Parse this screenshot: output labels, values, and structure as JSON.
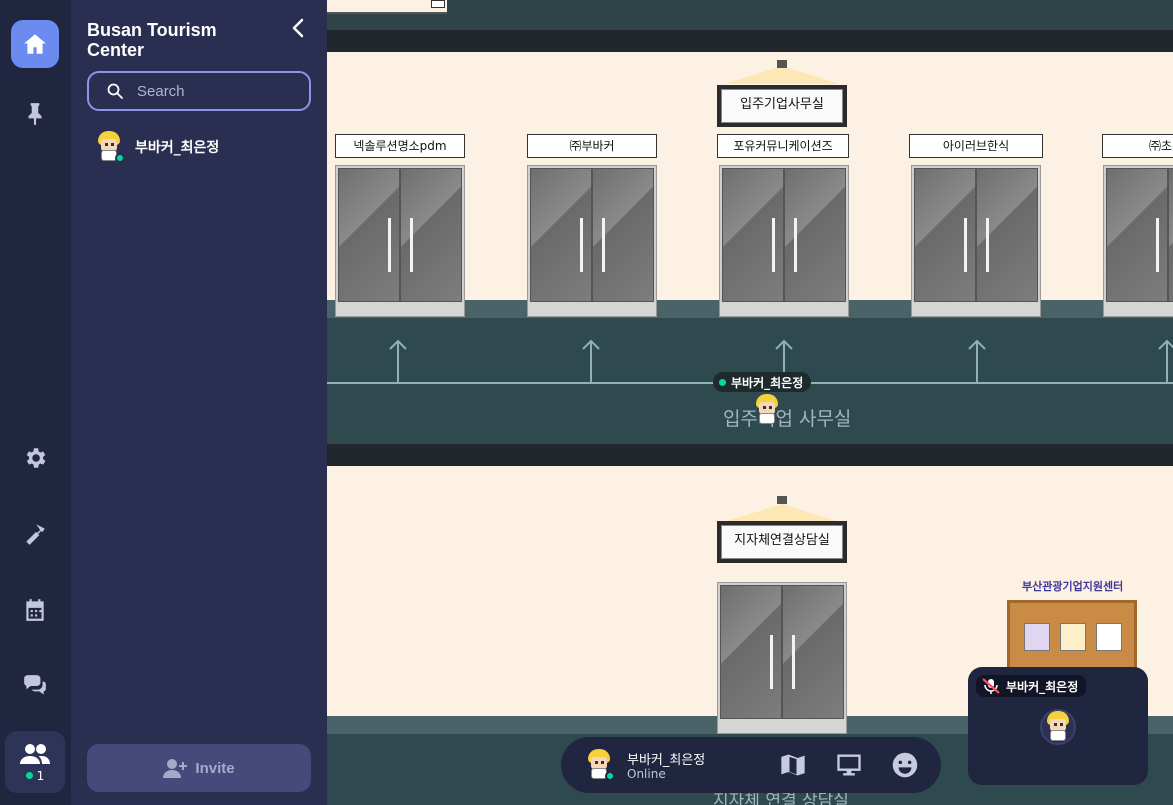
{
  "rail": {
    "items": [
      {
        "icon": "home-icon",
        "active": true
      },
      {
        "icon": "pin-icon",
        "active": false
      },
      {
        "icon": "gear-icon",
        "active": false
      },
      {
        "icon": "hammer-icon",
        "active": false
      },
      {
        "icon": "calendar-icon",
        "active": false
      },
      {
        "icon": "chat-icon",
        "active": false
      }
    ],
    "members_count": "1"
  },
  "sidebar": {
    "title": "Busan Tourism Center",
    "search_placeholder": "Search",
    "members": [
      {
        "name": "부바커_최은정",
        "status": "online"
      }
    ],
    "invite_label": "Invite"
  },
  "map": {
    "upper_room_sign": "입주기업사무실",
    "upper_doors": [
      "넥솔루션명소pdm",
      "㈜부바커",
      "포유커뮤니케이션즈",
      "아이러브한식",
      "㈜초록"
    ],
    "upper_room_label": "입주기업 사무실",
    "player_tag": "부바커_최은정",
    "lower_room_sign": "지자체연결상담실",
    "board_logo": "부산관광기업지원센터",
    "lower_room_label": "지자체 연결 상담실"
  },
  "control_bar": {
    "user_name": "부바커_최은정",
    "status": "Online",
    "buttons": [
      "map-icon",
      "screen-share-icon",
      "emoji-icon"
    ]
  },
  "video_tile": {
    "name": "부바커_최은정",
    "mic": "muted"
  },
  "colors": {
    "accent": "#6c8bf0",
    "online": "#06d6a0",
    "rail_bg": "#202540",
    "sidebar_bg": "#2a2e50"
  }
}
